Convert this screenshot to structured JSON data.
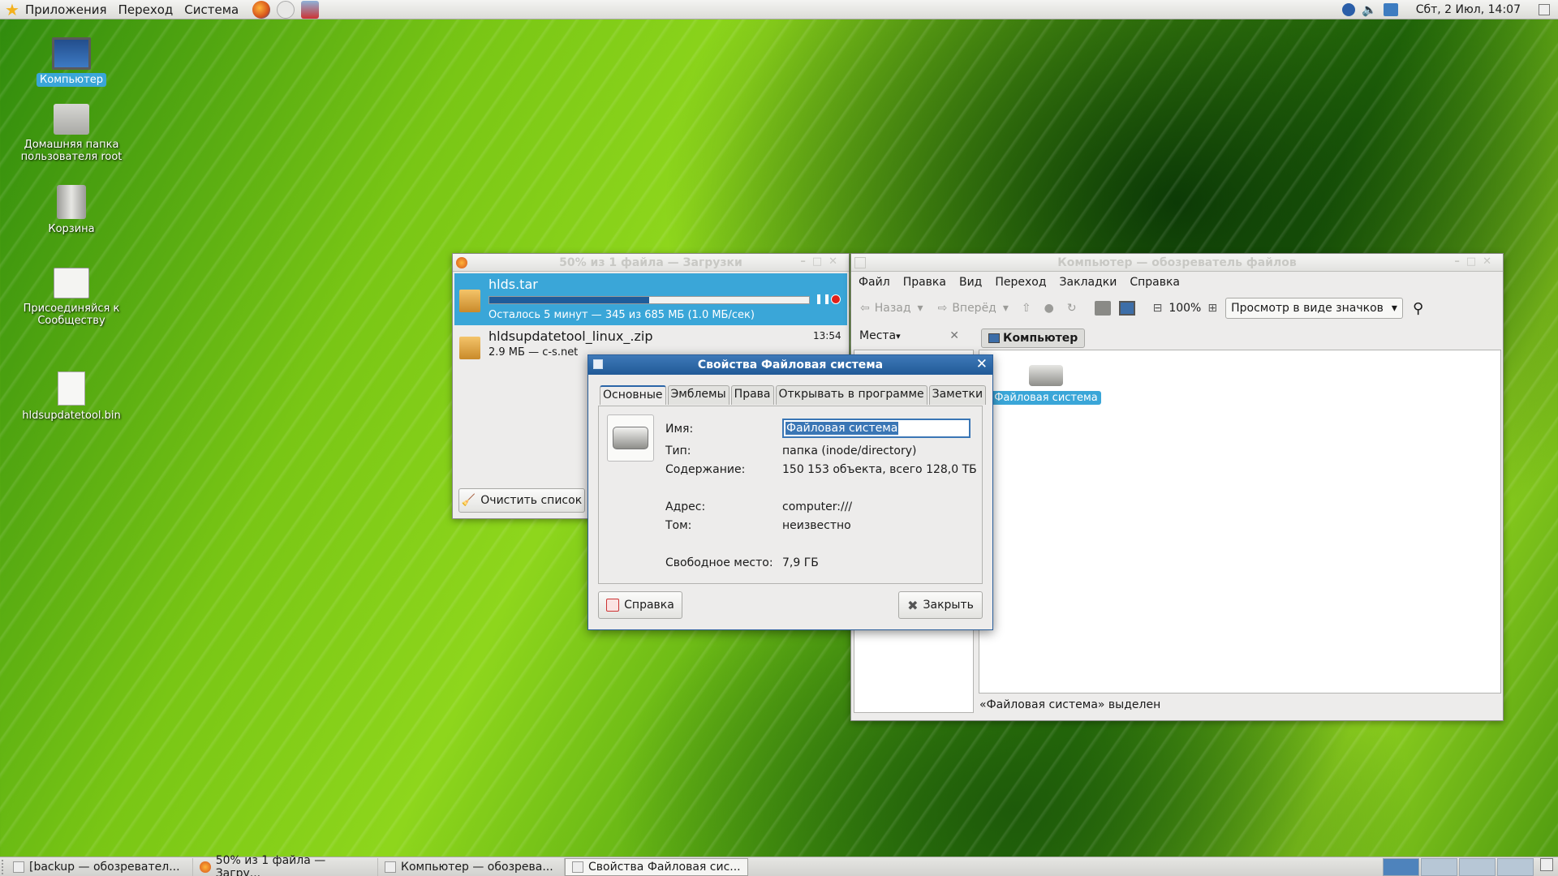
{
  "top_panel": {
    "menus": [
      "Приложения",
      "Переход",
      "Система"
    ],
    "clock": "Сбт, 2 Июл, 14:07"
  },
  "desktop": {
    "icons": [
      "Компьютер",
      "Домашняя папка пользователя root",
      "Корзина",
      "Присоединяйся к Сообществу",
      "hldsupdatetool.bin"
    ]
  },
  "downloads": {
    "title": "50% из 1 файла — Загрузки",
    "items": [
      {
        "name": "hlds.tar",
        "status": "Осталось 5 минут — 345 из 685 МБ (1.0 МБ/сек)",
        "progress": 0.5
      },
      {
        "name": "hldsupdatetool_linux_.zip",
        "status": "2.9 МБ — c-s.net",
        "time": "13:54"
      }
    ],
    "clear_label": "Очистить список"
  },
  "filemanager": {
    "title": "Компьютер — обозреватель файлов",
    "menu": [
      "Файл",
      "Правка",
      "Вид",
      "Переход",
      "Закладки",
      "Справка"
    ],
    "back_label": "Назад",
    "forward_label": "Вперёд",
    "zoom": "100%",
    "view_mode": "Просмотр в виде значков",
    "places_label": "Места",
    "location": "Компьютер",
    "item_label": "Файловая система",
    "status": "«Файловая система» выделен"
  },
  "dialog": {
    "title": "Свойства Файловая система",
    "tabs": [
      "Основные",
      "Эмблемы",
      "Права",
      "Открывать в программе",
      "Заметки"
    ],
    "name_label": "Имя:",
    "name_value": "Файловая система",
    "type_label": "Тип:",
    "type_value": "папка (inode/directory)",
    "contents_label": "Содержание:",
    "contents_value": "150 153 объекта, всего 128,0 ТБ",
    "address_label": "Адрес:",
    "address_value": "computer:///",
    "volume_label": "Том:",
    "volume_value": "неизвестно",
    "free_label": "Свободное место:",
    "free_value": "7,9 ГБ",
    "help_label": "Справка",
    "close_label": "Закрыть"
  },
  "taskbar": {
    "tasks": [
      "[backup — обозревател...",
      "50% из 1 файла — Загру...",
      "Компьютер — обозрева...",
      "Свойства Файловая сис..."
    ]
  }
}
